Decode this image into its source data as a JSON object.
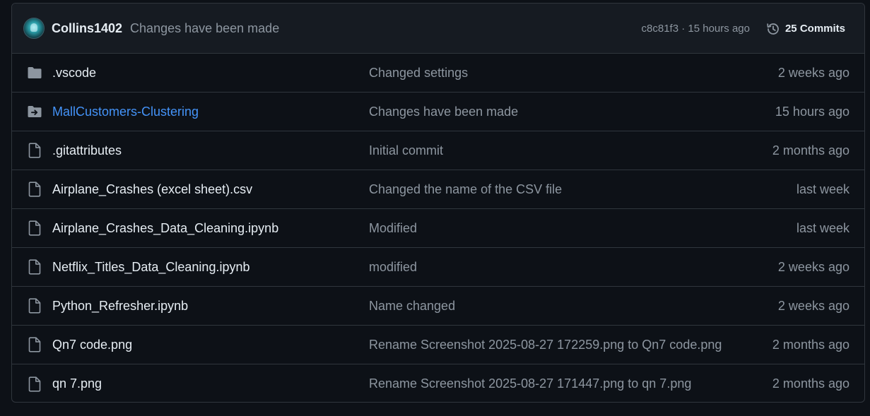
{
  "header": {
    "author": "Collins1402",
    "commit_message": "Changes have been made",
    "commit_meta": "c8c81f3 · 15 hours ago",
    "commits_label": "25 Commits",
    "history_icon": "history-icon",
    "avatar_icon": "avatar"
  },
  "files": [
    {
      "type": "folder",
      "icon": "folder-icon",
      "name": ".vscode",
      "message": "Changed settings",
      "time": "2 weeks ago"
    },
    {
      "type": "submodule",
      "icon": "folder-arrow-icon",
      "name": "MallCustomers-Clustering",
      "message": "Changes have been made",
      "time": "15 hours ago"
    },
    {
      "type": "file",
      "icon": "file-icon",
      "name": ".gitattributes",
      "message": "Initial commit",
      "time": "2 months ago"
    },
    {
      "type": "file",
      "icon": "file-icon",
      "name": "Airplane_Crashes (excel sheet).csv",
      "message": "Changed the name of the CSV file",
      "time": "last week"
    },
    {
      "type": "file",
      "icon": "file-icon",
      "name": "Airplane_Crashes_Data_Cleaning.ipynb",
      "message": "Modified",
      "time": "last week"
    },
    {
      "type": "file",
      "icon": "file-icon",
      "name": "Netflix_Titles_Data_Cleaning.ipynb",
      "message": "modified",
      "time": "2 weeks ago"
    },
    {
      "type": "file",
      "icon": "file-icon",
      "name": "Python_Refresher.ipynb",
      "message": "Name changed",
      "time": "2 weeks ago"
    },
    {
      "type": "file",
      "icon": "file-icon",
      "name": "Qn7 code.png",
      "message": "Rename Screenshot 2025-08-27 172259.png to Qn7 code.png",
      "time": "2 months ago"
    },
    {
      "type": "file",
      "icon": "file-icon",
      "name": "qn 7.png",
      "message": "Rename Screenshot 2025-08-27 171447.png to qn 7.png",
      "time": "2 months ago"
    }
  ],
  "colors": {
    "background": "#0d1117",
    "header_bg": "#161b22",
    "border": "#30363d",
    "text": "#e6edf3",
    "muted": "#8d96a0",
    "link": "#4493f8",
    "icon": "#8d96a0"
  }
}
